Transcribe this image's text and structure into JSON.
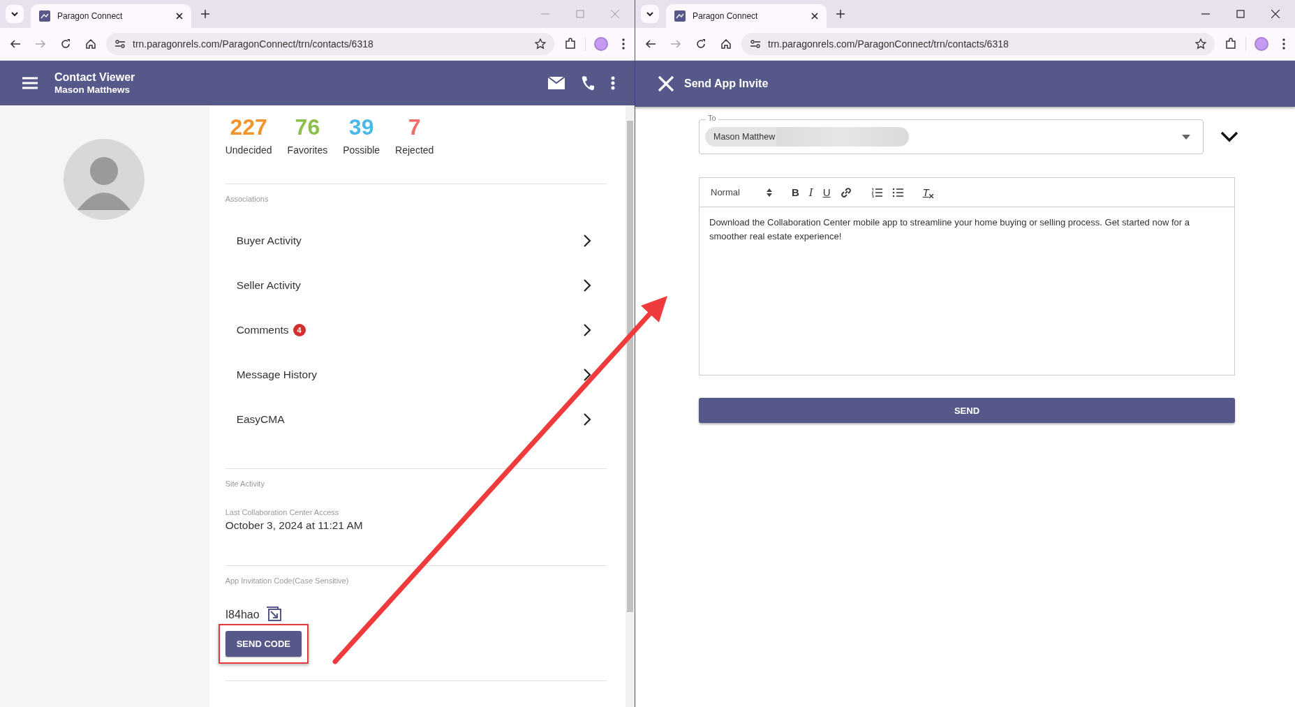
{
  "left_window": {
    "tab": {
      "title": "Paragon Connect"
    },
    "address": "trn.paragonrels.com/ParagonConnect/trn/contacts/6318",
    "header": {
      "title": "Contact Viewer",
      "subtitle": "Mason Matthews"
    },
    "stats": [
      {
        "value": "227",
        "label": "Undecided",
        "color": "#f0952b"
      },
      {
        "value": "76",
        "label": "Favorites",
        "color": "#8cbf4a"
      },
      {
        "value": "39",
        "label": "Possible",
        "color": "#4bb8e8"
      },
      {
        "value": "7",
        "label": "Rejected",
        "color": "#f26b6b"
      }
    ],
    "associations": {
      "heading": "Associations",
      "items": [
        {
          "label": "Buyer Activity"
        },
        {
          "label": "Seller Activity"
        },
        {
          "label": "Comments",
          "badge": "4"
        },
        {
          "label": "Message History"
        },
        {
          "label": "EasyCMA"
        }
      ]
    },
    "site_activity": {
      "heading": "Site Activity",
      "field_label": "Last Collaboration Center Access",
      "value": "October 3, 2024 at 11:21 AM"
    },
    "invitation": {
      "heading": "App Invitation Code(Case Sensitive)",
      "code": "I84hao",
      "button": "SEND CODE"
    }
  },
  "right_window": {
    "tab": {
      "title": "Paragon Connect"
    },
    "address": "trn.paragonrels.com/ParagonConnect/trn/contacts/6318",
    "header": {
      "title": "Send App Invite"
    },
    "to": {
      "label": "To",
      "recipient": "Mason Matthew"
    },
    "editor": {
      "format": "Normal",
      "toolbar": [
        {
          "kind": "bold",
          "glyph": "B"
        },
        {
          "kind": "italic",
          "glyph": "I"
        },
        {
          "kind": "underline",
          "glyph": "U"
        },
        {
          "kind": "link"
        },
        {
          "kind": "ordered"
        },
        {
          "kind": "bullet"
        },
        {
          "kind": "clean",
          "glyph": "T"
        }
      ],
      "body": "Download the Collaboration Center mobile app to streamline your home buying or selling process. Get started now for a smoother real estate experience!"
    },
    "send_button": "SEND"
  }
}
